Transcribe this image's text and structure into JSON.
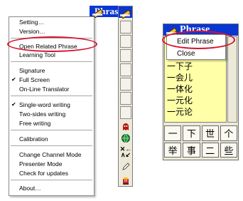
{
  "left_panel": {
    "title": "Phrase",
    "menu_items": [
      "Setting…",
      "Version…",
      "Open Related Phrase",
      "Learning Tool",
      "Signature",
      "Full Screen",
      "On-Line Translator",
      "Single-word writing",
      "Two-sides writing",
      "Free writing",
      "Calibration",
      "Change Channel Mode",
      "Presenter Mode",
      "Check for updates",
      "About…"
    ],
    "checked_items": [
      "Full Screen",
      "Single-word writing"
    ],
    "check_glyph": "✔",
    "highlighted_item": "Open Related Phrase",
    "toolbar_icons": [
      "pen-icon",
      "ghost-icon",
      "globe-icon",
      "arrows-icon",
      "pencil-icon",
      "red-robot-icon"
    ]
  },
  "right_panel": {
    "title": "Phrase",
    "context_menu": [
      "Edit Phrase",
      "Close"
    ],
    "highlighted_item": "Edit Phrase",
    "phrases": [
      "一下子",
      "一会儿",
      "一体化",
      "一元化",
      "一元论"
    ],
    "grid_chars": [
      "一",
      "下",
      "世",
      "个",
      "举",
      "事",
      "二",
      "些"
    ]
  },
  "colors": {
    "titlebar": "#0a36d2",
    "highlight": "#d8102a",
    "phrase_bg": "#ffffa8",
    "panel_bg": "#ece9d8"
  }
}
